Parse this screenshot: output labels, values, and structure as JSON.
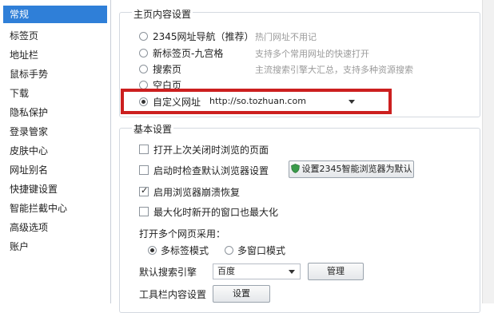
{
  "sidebar": {
    "items": [
      {
        "label": "常规"
      },
      {
        "label": "标签页"
      },
      {
        "label": "地址栏"
      },
      {
        "label": "鼠标手势"
      },
      {
        "label": "下载"
      },
      {
        "label": "隐私保护"
      },
      {
        "label": "登录管家"
      },
      {
        "label": "皮肤中心"
      },
      {
        "label": "网址别名"
      },
      {
        "label": "快捷键设置"
      },
      {
        "label": "智能拦截中心"
      },
      {
        "label": "高级选项"
      },
      {
        "label": "账户"
      }
    ],
    "selected": "常规"
  },
  "homepage": {
    "title": "主页内容设置",
    "options": [
      {
        "label": "2345网址导航（推荐）",
        "hint": "热门网址不用记"
      },
      {
        "label": "新标签页-九宫格",
        "hint": "支持多个常用网址的快速打开"
      },
      {
        "label": "搜索页",
        "hint": "主流搜索引擎大汇总，支持多种资源搜索"
      },
      {
        "label": "空白页",
        "hint": ""
      },
      {
        "label": "自定义网址",
        "hint": ""
      }
    ],
    "selected": "自定义网址",
    "custom_url": "http://so.tozhuan.com"
  },
  "basic": {
    "title": "基本设置",
    "checks": [
      {
        "label": "打开上次关闭时浏览的页面",
        "checked": false
      },
      {
        "label": "启动时检查默认浏览器设置",
        "checked": false
      },
      {
        "label": "启用浏览器崩溃恢复",
        "checked": true
      },
      {
        "label": "最大化时新开的窗口也最大化",
        "checked": false
      }
    ],
    "default_browser_button": "设置2345智能浏览器为默认",
    "multi_page_label": "打开多个网页采用：",
    "multi_page_modes": [
      {
        "label": "多标签模式"
      },
      {
        "label": "多窗口模式"
      }
    ],
    "multi_page_selected": "多标签模式",
    "search_engine_label": "默认搜索引擎",
    "search_engine_value": "百度",
    "manage_button": "管理",
    "toolbar_label": "工具栏内容设置",
    "toolbar_button": "设置"
  },
  "colors": {
    "accent": "#2f7fd8",
    "highlight": "#cc1f1f"
  }
}
